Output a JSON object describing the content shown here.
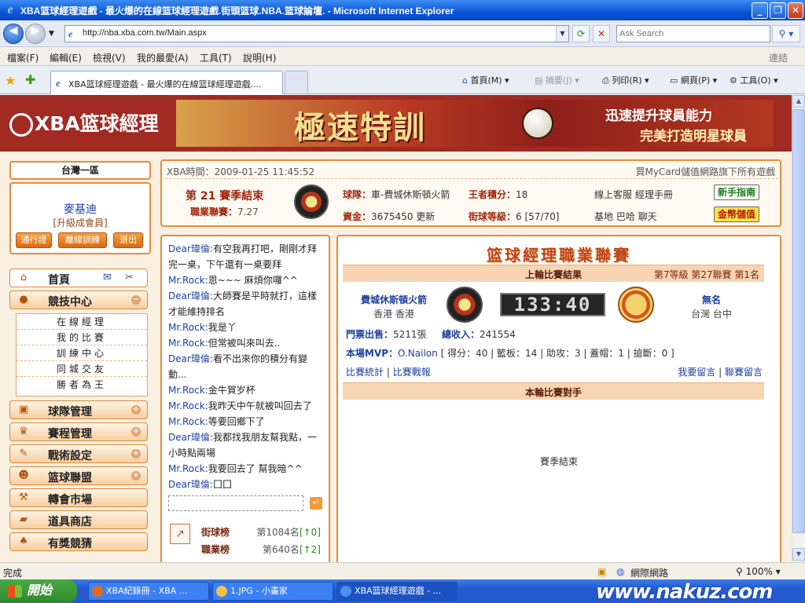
{
  "window": {
    "title": "XBA篮球經理遊戲 - 最火爆的在線篮球經理遊戲.街頭篮球.NBA.篮球論壇. - Microsoft Internet Explorer",
    "address": "http://nba.xba.com.tw/Main.aspx",
    "search_placeholder": "Ask Search"
  },
  "menu": {
    "items": [
      "檔案(F)",
      "編輯(E)",
      "檢視(V)",
      "我的最愛(A)",
      "工具(T)",
      "說明(H)"
    ],
    "links_label": "連結"
  },
  "tabs": {
    "active_tab": "XBA篮球經理遊戲 - 最火爆的在線篮球經理遊戲....",
    "home": "首頁(M)",
    "feeds": "摘要(J)",
    "print": "列印(R)",
    "page": "網頁(P)",
    "tools": "工具(O)"
  },
  "statusbar": {
    "left": "完成",
    "zone": "網際網路",
    "zoom": "100%"
  },
  "taskbar": {
    "start": "開始",
    "tasks": [
      "XBA紀錄冊 - XBA ...",
      "1.JPG - 小畫家",
      "XBA篮球經理遊戲 - ..."
    ],
    "watermark": "www.nakuz.com"
  },
  "site": {
    "logo": "XBA篮球經理",
    "ad": {
      "big": "極速特訓",
      "line1": "迅速提升球員能力",
      "line2": "完美打造明星球員"
    }
  },
  "user": {
    "region": "台灣一區",
    "name": "麥基迪",
    "upgrade": "[升級成會員]",
    "buttons": [
      "通行證",
      "離線訓練",
      "退出"
    ]
  },
  "nav": {
    "home": "首頁",
    "competition": "競技中心",
    "sub": [
      "在線經理",
      "我的比賽",
      "訓練中心",
      "同城交友",
      "勝者為王"
    ],
    "team": "球隊管理",
    "schedule": "賽程管理",
    "tactics": "戰術設定",
    "alliance": "篮球聯盟",
    "transfer": "轉會市場",
    "shop": "道具商店",
    "lottery": "有獎競猜"
  },
  "info": {
    "time": "XBA時間：2009-01-25 11:45:52",
    "mycard": "買MyCard儲值網路旗下所有遊戲",
    "season": "第 21 賽季結束",
    "pro_label": "職業聯賽：",
    "pro_value": "7.27",
    "team_label": "球隊：",
    "team_value": "車-費城休斯頓火箭",
    "king_label": "王者積分：",
    "king_value": "18",
    "cs": "線上客服  經理手冊",
    "fund_label": "資金：",
    "fund_value": "3675450",
    "update": "更新",
    "level_label": "街球等級：",
    "level_value": "6 [57/70]",
    "base": "基地  巴哈  聊天",
    "guide_btn": "新手指南",
    "coin_btn": "金幣儲值"
  },
  "chat": {
    "messages": [
      {
        "who": "Dear瑋倫:",
        "text": "有空我再打吧，剛剛才拜完一桌，下午還有一桌要拜"
      },
      {
        "who": "Mr.Rock:",
        "text": "恩~~~ 麻煩你囉^^"
      },
      {
        "who": "Dear瑋倫:",
        "text": "大師賽是平時就打，這樣才能維持排名"
      },
      {
        "who": "Mr.Rock:",
        "text": "我是丫"
      },
      {
        "who": "Mr.Rock:",
        "text": "但常被叫來叫去.."
      },
      {
        "who": "Dear瑋倫:",
        "text": "看不出來你的積分有變動..."
      },
      {
        "who": "Mr.Rock:",
        "text": "金牛賀岁杯"
      },
      {
        "who": "Mr.Rock:",
        "text": "我昨天中午就被叫回去了"
      },
      {
        "who": "Mr.Rock:",
        "text": "等要回鄉下了"
      },
      {
        "who": "Dear瑋倫:",
        "text": "我都找我朋友幫我點，一小時點兩場"
      },
      {
        "who": "Mr.Rock:",
        "text": "我要回去了  幫我暗^^"
      },
      {
        "who": "Dear瑋倫:",
        "text": "囗囗"
      }
    ],
    "rank_street_label": "街球榜",
    "rank_street_value": "第1084名",
    "rank_street_change": "[↑0]",
    "rank_pro_label": "職業榜",
    "rank_pro_value": "第640名",
    "rank_pro_change": "[↑2]"
  },
  "league": {
    "title": "篮球經理職業聯賽",
    "last_result": "上輪比賽結果",
    "level_info": "第7等級  第27聯賽  第1名",
    "home_team": "費城休斯頓火箭",
    "home_loc": "香港  香港",
    "score": "133:40",
    "away_team": "無名",
    "away_loc": "台灣  台中",
    "tickets_label": "門票出售：",
    "tickets_value": "5211張",
    "income_label": "總收入：",
    "income_value": "241554",
    "mvp_label": "本場MVP：",
    "mvp_value": "O.Nailon",
    "mvp_stats": "[ 得分：40 | 籃板：14 | 助攻：3 | 蓋帽：1 | 搶斷：0 ]",
    "stats_link": "比賽統計",
    "report_link": "比賽戰報",
    "msg_link": "我要留言",
    "league_msg_link": "聯賽留言",
    "next_opponent": "本輪比賽對手",
    "season_end": "賽季結束"
  }
}
